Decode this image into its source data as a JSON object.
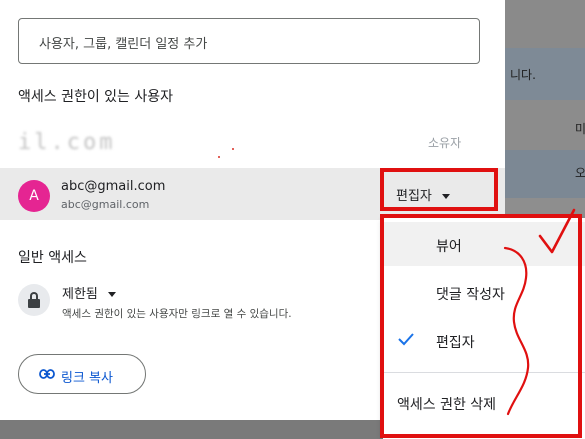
{
  "search": {
    "placeholder": "사용자, 그룹, 캘린더 일정 추가"
  },
  "people_section": {
    "title": "액세스 권한이 있는 사용자",
    "owner_email_blurred": "il.com",
    "owner_role": "소유자"
  },
  "user": {
    "avatar_letter": "A",
    "avatar_color": "#e52592",
    "name": "abc@gmail.com",
    "email": "abc@gmail.com",
    "role": "편집자"
  },
  "general_access": {
    "title": "일반 액세스",
    "setting": "제한됨",
    "description": "액세스 권한이 있는 사용자만 링크로 열 수 있습니다."
  },
  "copy_link": {
    "label": "링크 복사"
  },
  "role_menu": {
    "items": [
      {
        "label": "뷰어",
        "checked": false,
        "hovered": true
      },
      {
        "label": "댓글 작성자",
        "checked": false
      },
      {
        "label": "편집자",
        "checked": true
      }
    ],
    "remove_label": "액세스 권한 삭제"
  },
  "background": {
    "row1_text": "니다.",
    "row2_text": "미",
    "row3_text": "오"
  },
  "colors": {
    "annotation_red": "#e01010",
    "accent_blue": "#0b57d0",
    "check_blue": "#1a73e8"
  }
}
